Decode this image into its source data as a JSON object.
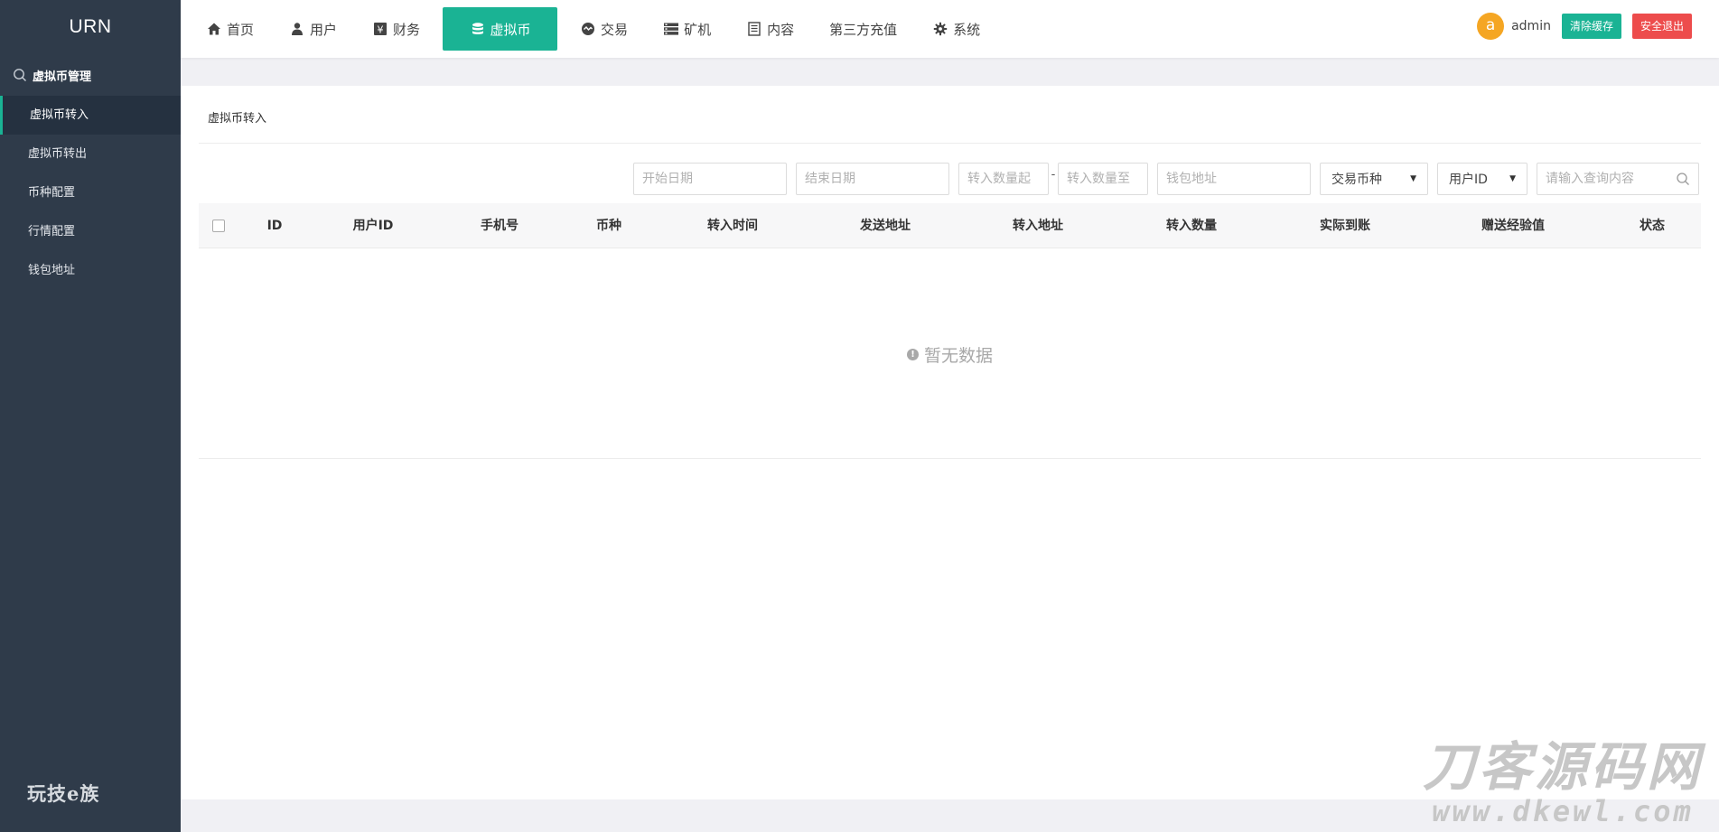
{
  "sidebar": {
    "logo": "URN",
    "group_title": "虚拟币管理",
    "items": [
      {
        "label": "虚拟币转入",
        "active": true
      },
      {
        "label": "虚拟币转出"
      },
      {
        "label": "币种配置"
      },
      {
        "label": "行情配置"
      },
      {
        "label": "钱包地址"
      }
    ],
    "footer": "玩技e族"
  },
  "topnav": {
    "items": [
      {
        "label": "首页",
        "icon": "home-icon"
      },
      {
        "label": "用户",
        "icon": "user-icon"
      },
      {
        "label": "财务",
        "icon": "yen-icon"
      },
      {
        "label": "虚拟币",
        "icon": "database-icon",
        "active": true
      },
      {
        "label": "交易",
        "icon": "exchange-icon"
      },
      {
        "label": "矿机",
        "icon": "server-icon"
      },
      {
        "label": "内容",
        "icon": "document-icon"
      },
      {
        "label": "第三方充值"
      },
      {
        "label": "系统",
        "icon": "gear-icon"
      }
    ],
    "avatar_letter": "a",
    "username": "admin",
    "clear_cache": "清除缓存",
    "logout": "安全退出"
  },
  "breadcrumb": "虚拟币转入",
  "filters": {
    "start_date": "开始日期",
    "end_date": "结束日期",
    "amount_from": "转入数量起",
    "separator": "-",
    "amount_to": "转入数量至",
    "wallet": "钱包地址",
    "currency_select": "交易币种",
    "field_select": "用户ID",
    "query": "请输入查询内容"
  },
  "table": {
    "headers": [
      "ID",
      "用户ID",
      "手机号",
      "币种",
      "转入时间",
      "发送地址",
      "转入地址",
      "转入数量",
      "实际到账",
      "赠送经验值",
      "状态"
    ],
    "empty_text": "暂无数据"
  },
  "watermark": {
    "line1": "刀客源码网",
    "line2": "www.dkewl.com"
  },
  "colors": {
    "sidebar": "#2f3b4a",
    "accent": "#1ab394",
    "danger": "#ed4c4c",
    "avatar": "#f5a623"
  }
}
